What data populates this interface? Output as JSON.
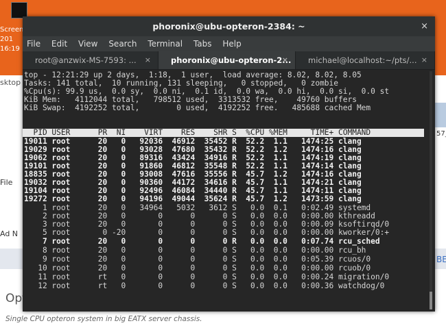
{
  "desktop": {
    "label_lines": [
      "Screen",
      "201",
      "16:19"
    ],
    "bg_ktop": "sktop",
    "bg_file": "File",
    "bg_ad": "Ad N",
    "bg_right1": "57_",
    "bg_right2": "BE",
    "heading": "Opt",
    "caption": "Single CPU opteron system in big EATX server chassis."
  },
  "window": {
    "title": "phoronix@ubu-opteron-2384: ~",
    "close_glyph": "×",
    "menu": [
      "File",
      "Edit",
      "View",
      "Search",
      "Terminal",
      "Tabs",
      "Help"
    ],
    "tabs": [
      {
        "label": "root@anzwix-MS-7593: ...",
        "close": "×"
      },
      {
        "label": "phoronix@ubu-opteron-2...",
        "close": "×"
      },
      {
        "label": "michael@localhost:~/pts/...",
        "close": "×"
      }
    ]
  },
  "top": {
    "summary": [
      "top - 12:21:29 up 2 days,  1:18,  1 user,  load average: 8.02, 8.02, 8.05",
      "Tasks: 141 total,  10 running, 131 sleeping,   0 stopped,   0 zombie",
      "%Cpu(s): 99.9 us,  0.0 sy,  0.0 ni,  0.1 id,  0.0 wa,  0.0 hi,  0.0 si,  0.0 st",
      "KiB Mem:   4112044 total,   798512 used,  3313532 free,    49760 buffers",
      "KiB Swap:  4192252 total,        0 used,  4192252 free.   485688 cached Mem"
    ],
    "header": "  PID USER      PR  NI    VIRT    RES    SHR S  %CPU %MEM     TIME+ COMMAND",
    "processes": [
      {
        "line": "19011 root      20   0   92036  46912  35452 R  52.2  1.1   1474:25 clang",
        "bold": true
      },
      {
        "line": "19029 root      20   0   93028  47680  35432 R  52.2  1.2   1474:16 clang",
        "bold": true
      },
      {
        "line": "19062 root      20   0   89316  43424  34916 R  52.2  1.1   1474:19 clang",
        "bold": true
      },
      {
        "line": "19101 root      20   0   91860  46812  35548 R  52.2  1.1   1474:14 clang",
        "bold": true
      },
      {
        "line": "18835 root      20   0   93008  47616  35556 R  45.7  1.2   1474:16 clang",
        "bold": true
      },
      {
        "line": "19032 root      20   0   90360  44172  34616 R  45.7  1.1   1474:21 clang",
        "bold": true
      },
      {
        "line": "19104 root      20   0   92496  46084  34440 R  45.7  1.1   1474:11 clang",
        "bold": true
      },
      {
        "line": "19272 root      20   0   94196  49044  35624 R  45.7  1.2   1473:59 clang",
        "bold": true
      },
      {
        "line": "    1 root      20   0   34964   5032   3612 S   0.0  0.1   0:02.49 systemd",
        "bold": false
      },
      {
        "line": "    2 root      20   0       0      0      0 S   0.0  0.0   0:00.00 kthreadd",
        "bold": false
      },
      {
        "line": "    3 root      20   0       0      0      0 S   0.0  0.0   0:00.09 ksoftirqd/0",
        "bold": false
      },
      {
        "line": "    5 root       0 -20       0      0      0 S   0.0  0.0   0:00.00 kworker/0:+",
        "bold": false
      },
      {
        "line": "    7 root      20   0       0      0      0 R   0.0  0.0   0:07.74 rcu_sched",
        "bold": true
      },
      {
        "line": "    8 root      20   0       0      0      0 S   0.0  0.0   0:00.00 rcu_bh",
        "bold": false
      },
      {
        "line": "    9 root      20   0       0      0      0 S   0.0  0.0   0:05.39 rcuos/0",
        "bold": false
      },
      {
        "line": "   10 root      20   0       0      0      0 S   0.0  0.0   0:00.00 rcuob/0",
        "bold": false
      },
      {
        "line": "   11 root      rt   0       0      0      0 S   0.0  0.0   0:00.24 migration/0",
        "bold": false
      },
      {
        "line": "   12 root      rt   0       0      0      0 S   0.0  0.0   0:00.36 watchdog/0",
        "bold": false
      }
    ]
  },
  "colors": {
    "terminal_bg": "#262626",
    "header_bg": "#e6e6e6",
    "desktop_accent": "#e8641c"
  }
}
